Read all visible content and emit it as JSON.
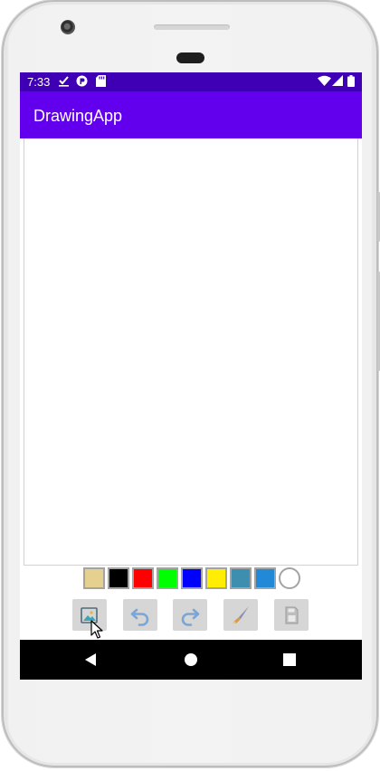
{
  "status_bar": {
    "time": "7:33",
    "left_icons": [
      "download-done-icon",
      "app-notification-icon",
      "sd-card-icon"
    ],
    "right_icons": [
      "wifi-icon",
      "cell-signal-icon",
      "battery-icon"
    ]
  },
  "app_bar": {
    "title": "DrawingApp"
  },
  "palette": {
    "colors": [
      "#e6d08f",
      "#000000",
      "#ff0000",
      "#00ff00",
      "#0000ff",
      "#ffee00",
      "#3d8fb0",
      "#2289d8",
      "#ffffff"
    ]
  },
  "toolbar": {
    "buttons": [
      "image-gallery-icon",
      "undo-icon",
      "redo-icon",
      "brush-icon",
      "save-icon"
    ]
  },
  "nav_bar": {
    "buttons": [
      "back-icon",
      "home-icon",
      "recents-icon"
    ]
  }
}
